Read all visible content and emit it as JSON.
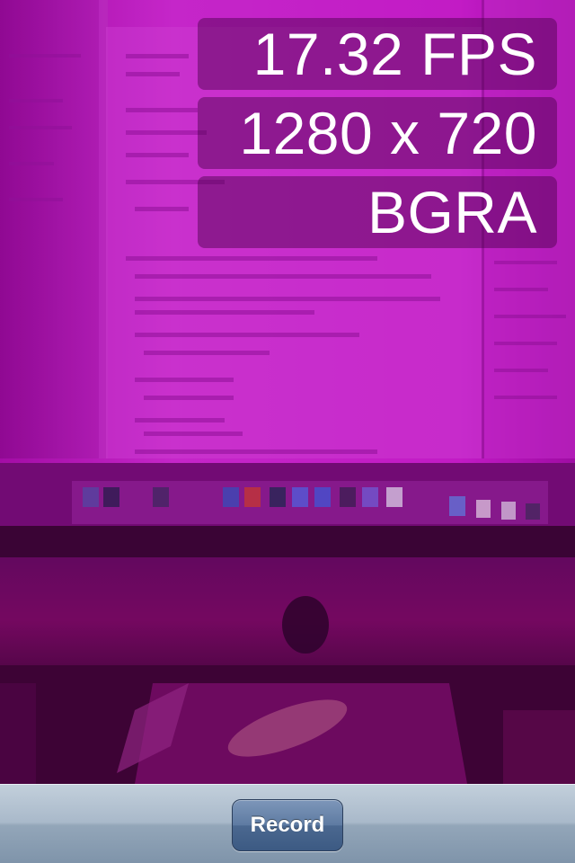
{
  "camera_view": {
    "description_icon": "camera-feed",
    "tint_color": "#b20fb4"
  },
  "stats": {
    "fps": "17.32 FPS",
    "resolution": "1280 x 720",
    "pixel_format": "BGRA"
  },
  "toolbar": {
    "record_label": "Record"
  }
}
